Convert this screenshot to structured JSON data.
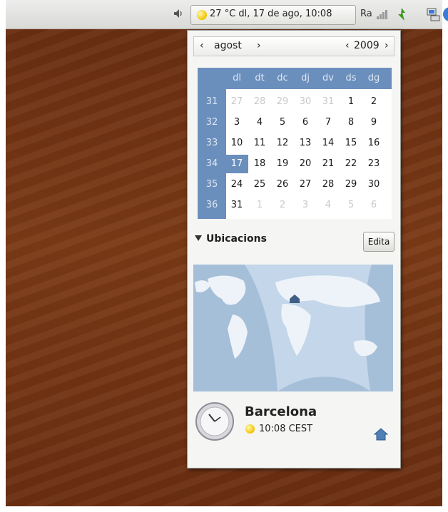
{
  "panel": {
    "clock_text": "27 °C  dl, 17 de ago, 10:08",
    "user_name": "Ra"
  },
  "calendar": {
    "prev_month": "‹",
    "month": "agost",
    "next_month": "›",
    "prev_year": "‹",
    "year": "2009",
    "next_year": "›",
    "day_names": [
      "dl",
      "dt",
      "dc",
      "dj",
      "dv",
      "ds",
      "dg"
    ],
    "week_numbers": [
      "31",
      "32",
      "33",
      "34",
      "35",
      "36"
    ],
    "weeks": [
      [
        "27",
        "28",
        "29",
        "30",
        "31",
        "1",
        "2"
      ],
      [
        "3",
        "4",
        "5",
        "6",
        "7",
        "8",
        "9"
      ],
      [
        "10",
        "11",
        "12",
        "13",
        "14",
        "15",
        "16"
      ],
      [
        "17",
        "18",
        "19",
        "20",
        "21",
        "22",
        "23"
      ],
      [
        "24",
        "25",
        "26",
        "27",
        "28",
        "29",
        "30"
      ],
      [
        "31",
        "1",
        "2",
        "3",
        "4",
        "5",
        "6"
      ]
    ],
    "outside_month": [
      [
        0,
        0
      ],
      [
        0,
        1
      ],
      [
        0,
        2
      ],
      [
        0,
        3
      ],
      [
        0,
        4
      ],
      [
        5,
        1
      ],
      [
        5,
        2
      ],
      [
        5,
        3
      ],
      [
        5,
        4
      ],
      [
        5,
        5
      ],
      [
        5,
        6
      ]
    ],
    "today": [
      3,
      0
    ]
  },
  "locations": {
    "title": "Ubicacions",
    "edit_label": "Edita",
    "city": "Barcelona",
    "time": "10:08 CEST"
  },
  "colors": {
    "accent": "#6b8fbd",
    "sun": "#f2c400"
  }
}
